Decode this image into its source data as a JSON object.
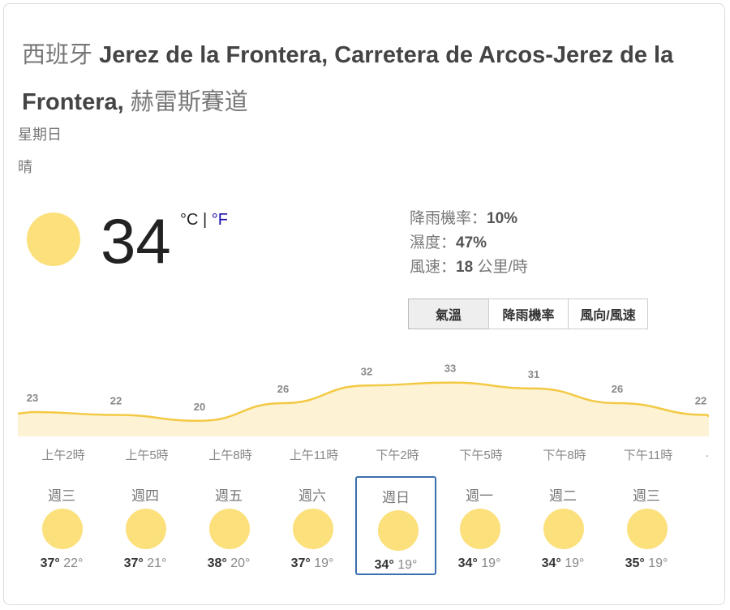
{
  "location": {
    "prefix": "西班牙",
    "name_line": "Jerez de la Frontera, Carretera de Arcos-Jerez de la Frontera,",
    "suffix": "赫雷斯賽道"
  },
  "day": "星期日",
  "condition": "晴",
  "current": {
    "temp": "34",
    "unit_c": "°C",
    "unit_sep": "|",
    "unit_f": "°F"
  },
  "details": {
    "precip_label": "降雨機率：",
    "precip_value": "10%",
    "humidity_label": "濕度：",
    "humidity_value": "47%",
    "wind_label": "風速：",
    "wind_value": "18",
    "wind_unit": "公里/時"
  },
  "tabs": [
    "氣溫",
    "降雨機率",
    "風向/風速"
  ],
  "chart_data": {
    "type": "area",
    "x": [
      "上午2時",
      "上午5時",
      "上午8時",
      "上午11時",
      "下午2時",
      "下午5時",
      "下午8時",
      "下午11時"
    ],
    "values": [
      23,
      22,
      20,
      26,
      32,
      33,
      31,
      26,
      22
    ],
    "color": "#f3c944",
    "fill": "#fdf3d4"
  },
  "times": [
    "上午2時",
    "上午5時",
    "上午8時",
    "上午11時",
    "下午2時",
    "下午5時",
    "下午8時",
    "下午11時",
    "."
  ],
  "forecast": [
    {
      "day": "週三",
      "hi": "37°",
      "lo": "22°"
    },
    {
      "day": "週四",
      "hi": "37°",
      "lo": "21°"
    },
    {
      "day": "週五",
      "hi": "38°",
      "lo": "20°"
    },
    {
      "day": "週六",
      "hi": "37°",
      "lo": "19°"
    },
    {
      "day": "週日",
      "hi": "34°",
      "lo": "19°"
    },
    {
      "day": "週一",
      "hi": "34°",
      "lo": "19°"
    },
    {
      "day": "週二",
      "hi": "34°",
      "lo": "19°"
    },
    {
      "day": "週三",
      "hi": "35°",
      "lo": "19°"
    }
  ],
  "colors": {
    "sun": "#fbe07c",
    "selected_border": "#3a6fb0",
    "link": "#1a0dab"
  }
}
